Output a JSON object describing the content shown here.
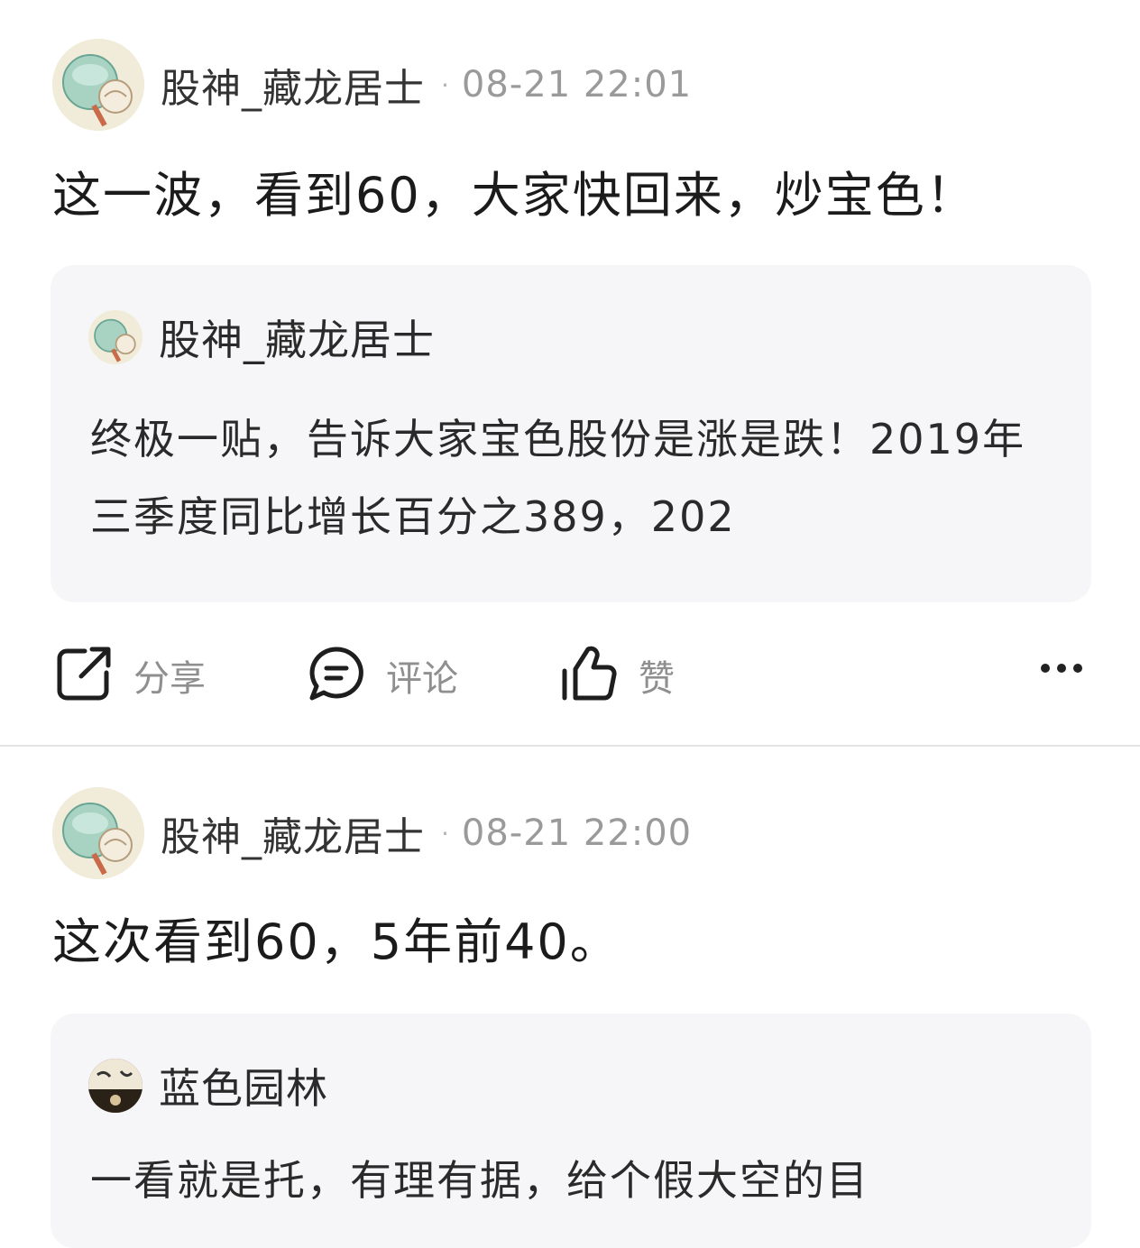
{
  "posts": [
    {
      "author": "股神_藏龙居士",
      "separator": "·",
      "time": "08-21 22:01",
      "body": "这一波，看到60，大家快回来，炒宝色！",
      "quote": {
        "author": "股神_藏龙居士",
        "text": "终极一贴，告诉大家宝色股份是涨是跌！2019年三季度同比增长百分之389，202"
      },
      "actions": {
        "share": "分享",
        "comment": "评论",
        "like": "赞"
      }
    },
    {
      "author": "股神_藏龙居士",
      "separator": "·",
      "time": "08-21 22:00",
      "body": "这次看到60，5年前40。",
      "quote": {
        "author": "蓝色园林",
        "text": "一看就是托，有理有据，给个假大空的目"
      }
    }
  ],
  "colors": {
    "background": "#ffffff",
    "quote_bg": "#f6f6f8",
    "text": "#1b1b1b",
    "meta": "#9a9a9a",
    "action_label": "#8f8f8f"
  },
  "icons": [
    "share-icon",
    "comment-icon",
    "like-icon",
    "more-icon",
    "avatar"
  ]
}
